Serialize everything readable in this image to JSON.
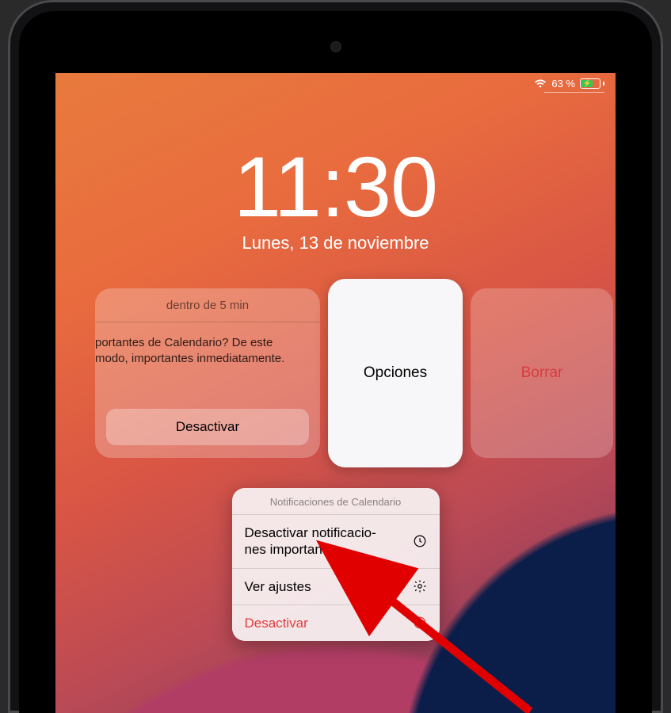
{
  "status": {
    "battery_pct": "63 %",
    "wifi_icon": "wifi-icon",
    "charging": true
  },
  "clock": {
    "time": "11:30",
    "date_line": "Lunes, 13 de noviembre"
  },
  "notification": {
    "header": "dentro de 5 min",
    "body_text": "portantes de Calendario? De este modo, importantes inmediatamente.",
    "button_label": "Desactivar"
  },
  "swipe_actions": {
    "options_label": "Opciones",
    "clear_label": "Borrar"
  },
  "popover": {
    "title": "Notificaciones de Calendario",
    "rows": [
      {
        "label": "Desactivar notificacio-\nnes importantes",
        "icon": "clock-icon",
        "style": "default"
      },
      {
        "label": "Ver ajustes",
        "icon": "gear-icon",
        "style": "default"
      },
      {
        "label": "Desactivar",
        "icon": "minus-circle-icon",
        "style": "red"
      }
    ]
  },
  "annotation": {
    "target": "popover.rows.2",
    "type": "red-arrow"
  }
}
